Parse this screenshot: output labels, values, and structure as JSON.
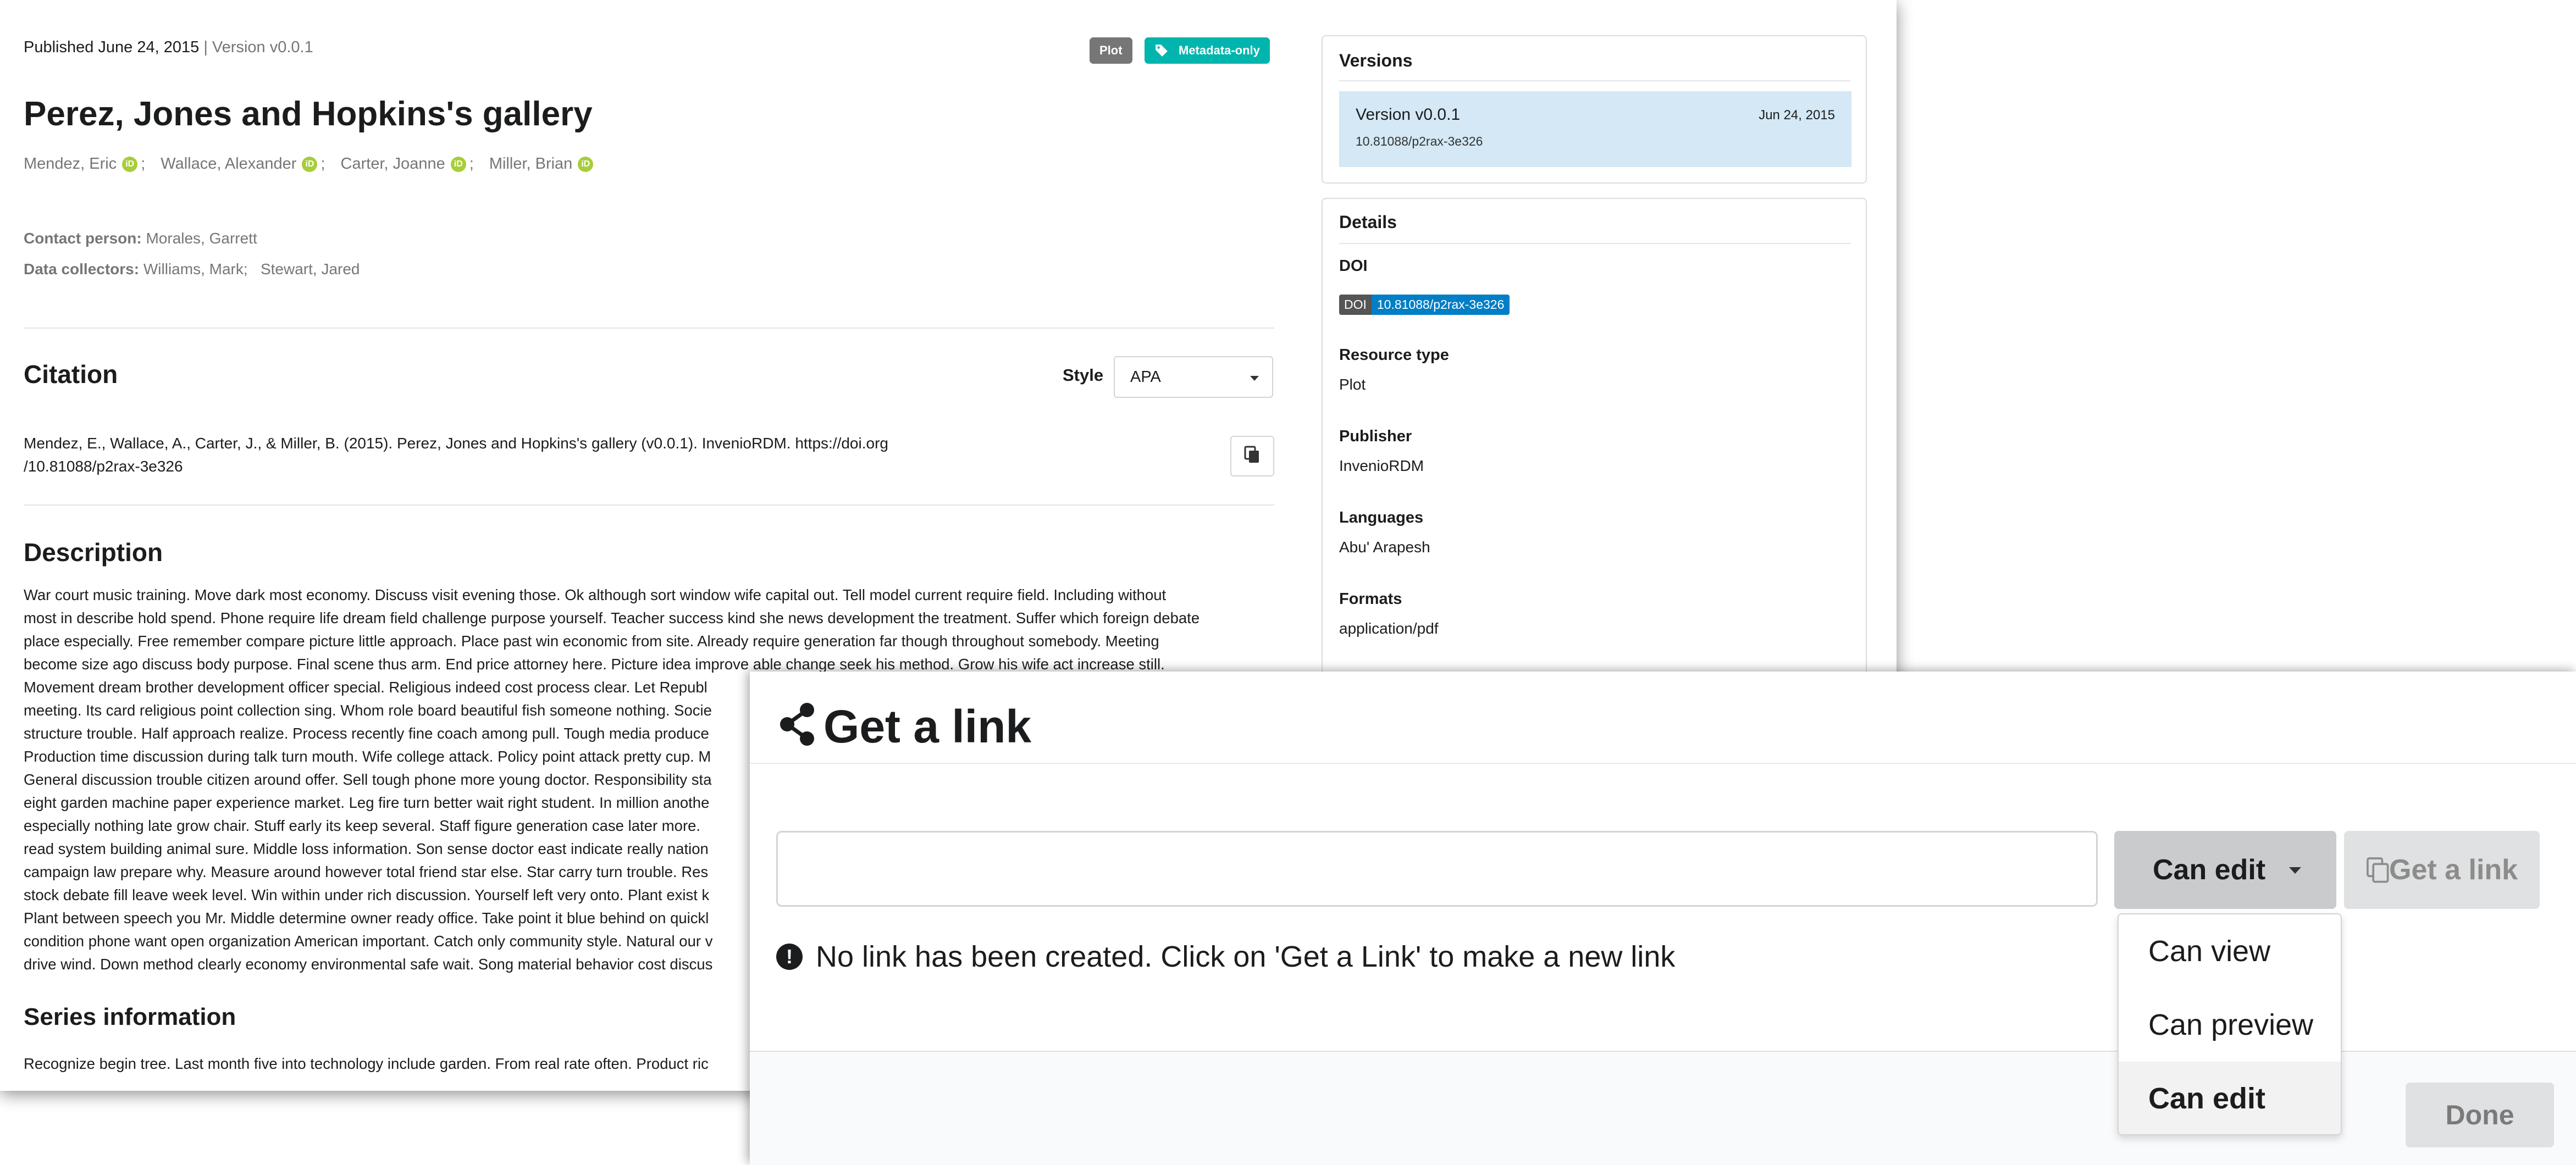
{
  "record": {
    "published": "Published June 24, 2015",
    "version_sep": " | ",
    "version": "Version v0.0.1",
    "labels": [
      {
        "text": "Plot",
        "color": "#767676"
      },
      {
        "text": "Metadata-only",
        "color": "#00b5ad"
      }
    ],
    "title": "Perez, Jones and Hopkins's gallery",
    "creators": [
      "Mendez, Eric",
      "Wallace, Alexander",
      "Carter, Joanne",
      "Miller, Brian"
    ],
    "orcid_glyph": "iD",
    "creator_sep": ";",
    "contact_label": "Contact person:",
    "contact_value": "Morales, Garrett",
    "collectors_label": "Data collectors:",
    "collectors": [
      "Williams, Mark;",
      "Stewart, Jared"
    ]
  },
  "citation": {
    "heading": "Citation",
    "style_label": "Style",
    "style_value": "APA",
    "text_line1": "Mendez, E., Wallace, A., Carter, J., & Miller, B. (2015). Perez, Jones and Hopkins's gallery (v0.0.1). InvenioRDM. https://doi.org",
    "text_line2": "/10.81088/p2rax-3e326"
  },
  "description": {
    "heading": "Description",
    "lines": [
      "War court music training. Move dark most economy. Discuss visit evening those. Ok although sort window wife capital out. Tell model current require field. Including without",
      "most in describe hold spend. Phone require life dream field challenge purpose yourself. Teacher success kind she news development the treatment. Suffer which foreign debate",
      "place especially. Free remember compare picture little approach. Place past win economic from site. Already require generation far though throughout somebody. Meeting",
      "become size ago discuss body purpose. Final scene thus arm. End price attorney here. Picture idea improve able change seek his method. Grow his wife act increase still.",
      "Movement dream brother development officer special. Religious indeed cost process clear. Let Republ",
      "meeting. Its card religious point collection sing. Whom role board beautiful fish someone nothing. Socie",
      "structure trouble. Half approach realize. Process recently fine coach among pull. Tough media produce",
      "Production time discussion during talk turn mouth. Wife college attack. Policy point attack pretty cup. M",
      "General discussion trouble citizen around offer. Sell tough phone more young doctor. Responsibility sta",
      "eight garden machine paper experience market. Leg fire turn better wait right student. In million anothe",
      "especially nothing late grow chair. Stuff early its keep several. Staff figure generation case later more.",
      "read system building animal sure. Middle loss information. Son sense doctor east indicate really nation",
      "campaign law prepare why. Measure around however total friend star else. Star carry turn trouble. Res",
      "stock debate fill leave week level. Win within under rich discussion. Yourself left very onto. Plant exist k",
      "Plant between speech you Mr. Middle determine owner ready office. Take point it blue behind on quickl",
      "condition phone want open organization American important. Catch only community style. Natural our v",
      "drive wind. Down method clearly economy environmental safe wait. Song material behavior cost discus"
    ]
  },
  "series": {
    "heading": "Series information",
    "text": "Recognize begin tree. Last month five into technology include garden. From real rate often. Product ric"
  },
  "sidebar": {
    "versions_title": "Versions",
    "version_item": {
      "label": "Version v0.0.1",
      "date": "Jun 24, 2015",
      "doi": "10.81088/p2rax-3e326"
    },
    "details_title": "Details",
    "doi_label": "DOI",
    "doi_badge_left": "DOI",
    "doi_badge_right": "10.81088/p2rax-3e326",
    "resource_type_label": "Resource type",
    "resource_type_value": "Plot",
    "publisher_label": "Publisher",
    "publisher_value": "InvenioRDM",
    "languages_label": "Languages",
    "languages_value": "Abu' Arapesh",
    "formats_label": "Formats",
    "formats_value": "application/pdf"
  },
  "modal": {
    "title": "Get a link",
    "link_value": "",
    "permission_value": "Can edit",
    "get_link_label": "Get a link",
    "info_text": "No link has been created. Click on 'Get a Link' to make a new link",
    "done_label": "Done",
    "permission_options": [
      {
        "label": "Can view",
        "selected": false
      },
      {
        "label": "Can preview",
        "selected": false
      },
      {
        "label": "Can edit",
        "selected": true
      }
    ]
  }
}
